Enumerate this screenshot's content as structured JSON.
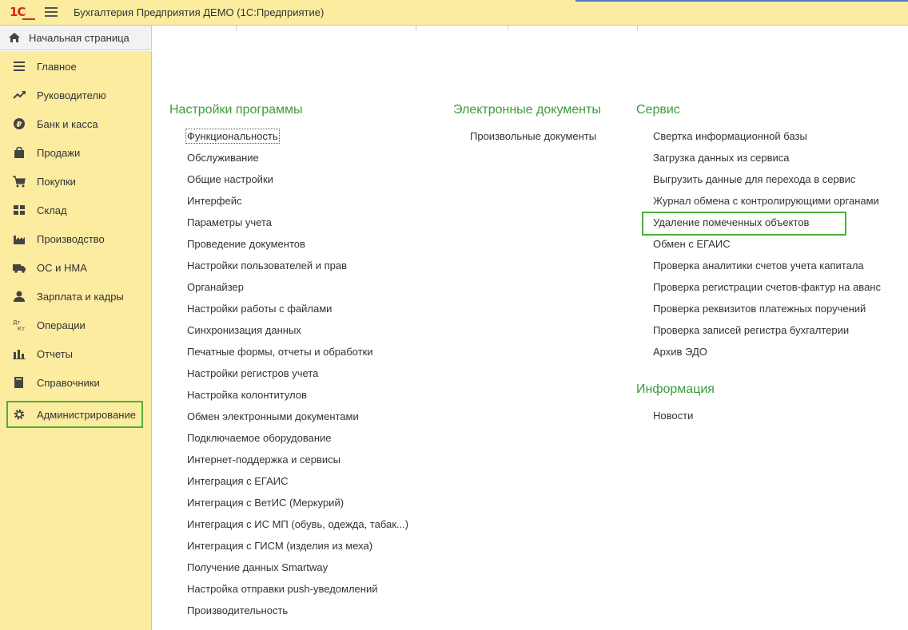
{
  "titlebar": {
    "logo": "1С",
    "title": "Бухгалтерия Предприятия ДЕМО  (1С:Предприятие)"
  },
  "home_tab": {
    "label": "Начальная страница"
  },
  "sidebar": {
    "items": [
      {
        "label": "Главное",
        "icon": "list-icon"
      },
      {
        "label": "Руководителю",
        "icon": "trend-icon"
      },
      {
        "label": "Банк и касса",
        "icon": "ruble-icon"
      },
      {
        "label": "Продажи",
        "icon": "bag-icon"
      },
      {
        "label": "Покупки",
        "icon": "cart-icon"
      },
      {
        "label": "Склад",
        "icon": "warehouse-icon"
      },
      {
        "label": "Производство",
        "icon": "factory-icon"
      },
      {
        "label": "ОС и НМА",
        "icon": "truck-icon"
      },
      {
        "label": "Зарплата и кадры",
        "icon": "person-icon"
      },
      {
        "label": "Операции",
        "icon": "dt-kt-icon"
      },
      {
        "label": "Отчеты",
        "icon": "bar-chart-icon"
      },
      {
        "label": "Справочники",
        "icon": "book-icon"
      },
      {
        "label": "Администрирование",
        "icon": "gear-icon",
        "selected": true
      }
    ]
  },
  "sections": {
    "settings": {
      "title": "Настройки программы",
      "links": [
        "Функциональность",
        "Обслуживание",
        "Общие настройки",
        "Интерфейс",
        "Параметры учета",
        "Проведение документов",
        "Настройки пользователей и прав",
        "Органайзер",
        "Настройки работы с файлами",
        "Синхронизация данных",
        "Печатные формы, отчеты и обработки",
        "Настройки регистров учета",
        "Настройка колонтитулов",
        "Обмен электронными документами",
        "Подключаемое оборудование",
        "Интернет-поддержка и сервисы",
        "Интеграция с ЕГАИС",
        "Интеграция с ВетИС (Меркурий)",
        "Интеграция с ИС МП (обувь, одежда, табак...)",
        "Интеграция с ГИСМ (изделия из меха)",
        "Получение данных Smartway",
        "Настройка отправки push-уведомлений",
        "Производительность"
      ]
    },
    "edocs": {
      "title": "Электронные документы",
      "links": [
        "Произвольные документы"
      ]
    },
    "service": {
      "title": "Сервис",
      "links": [
        "Свертка информационной базы",
        "Загрузка данных из сервиса",
        "Выгрузить данные для перехода в сервис",
        "Журнал обмена с контролирующими органами",
        "Удаление помеченных объектов",
        "Обмен с ЕГАИС",
        "Проверка аналитики счетов учета капитала",
        "Проверка регистрации счетов-фактур на аванс",
        "Проверка реквизитов платежных поручений",
        "Проверка записей регистра бухгалтерии",
        "Архив ЭДО"
      ]
    },
    "info": {
      "title": "Информация",
      "links": [
        "Новости"
      ]
    }
  },
  "colors": {
    "accent_green": "#3d9b3d",
    "highlight": "#4cb13a",
    "sidebar_bg": "#fbeca0"
  }
}
